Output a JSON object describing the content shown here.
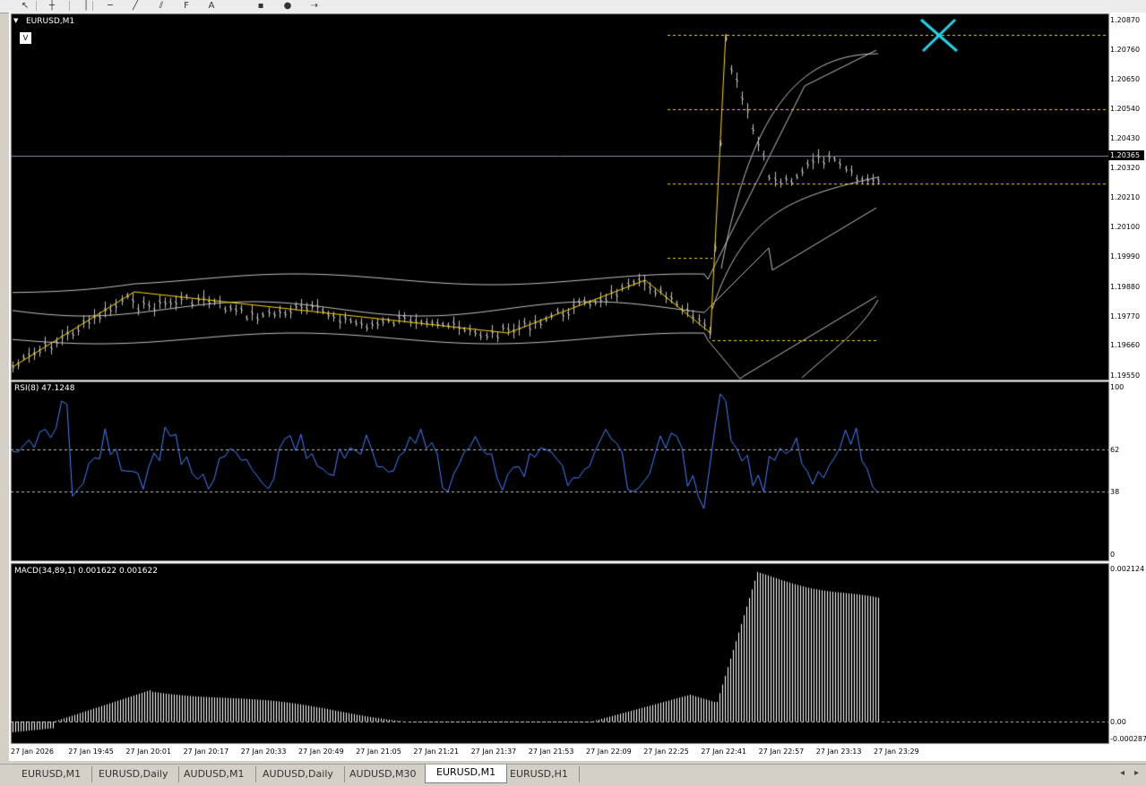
{
  "toolbar": {
    "buttons": [
      {
        "name": "cursor-icon",
        "glyph": "↖"
      },
      {
        "name": "crosshair-icon",
        "glyph": "┼"
      },
      {
        "name": "vertical-line-icon",
        "glyph": "│"
      },
      {
        "name": "horizontal-line-icon",
        "glyph": "─"
      },
      {
        "name": "trendline-icon",
        "glyph": "╱"
      },
      {
        "name": "equidistant-channel-icon",
        "glyph": "⫽"
      },
      {
        "name": "fibonacci-icon",
        "glyph": "F"
      },
      {
        "name": "text-icon",
        "glyph": "A"
      },
      {
        "name": "rectangle-icon",
        "glyph": "▪"
      },
      {
        "name": "ellipse-icon",
        "glyph": "●"
      },
      {
        "name": "arrows-icon",
        "glyph": "⇢"
      }
    ]
  },
  "chart": {
    "symbol_label": "EURUSD,M1",
    "v_button": "V",
    "current_price": "1.20365",
    "price_axis": [
      "1.20870",
      "1.20760",
      "1.20650",
      "1.20540",
      "1.20430",
      "1.20320",
      "1.20210",
      "1.20100",
      "1.19990",
      "1.19880",
      "1.19770",
      "1.19660",
      "1.19550"
    ],
    "rsi_label": "RSI(8) 47.1248",
    "rsi_axis": [
      "100",
      "62",
      "38",
      "0"
    ],
    "macd_label": "MACD(34,89,1) 0.001622 0.001622",
    "macd_axis": [
      "0.002124",
      "0.00",
      "-0.000287"
    ],
    "time_axis": [
      "27 Jan 2026",
      "27 Jan 19:45",
      "27 Jan 20:01",
      "27 Jan 20:17",
      "27 Jan 20:33",
      "27 Jan 20:49",
      "27 Jan 21:05",
      "27 Jan 21:21",
      "27 Jan 21:37",
      "27 Jan 21:53",
      "27 Jan 22:09",
      "27 Jan 22:25",
      "27 Jan 22:41",
      "27 Jan 22:57",
      "27 Jan 23:13",
      "27 Jan 23:29"
    ],
    "colors": {
      "background": "#000000",
      "candles": "#c0c0c0",
      "zigzag": "#ffd700",
      "bands": "#c0c0c0",
      "level_lines": "#ffd700",
      "rsi": "#4a7fff",
      "macd": "#ffffff",
      "cross_marker": "#22d3e6"
    }
  },
  "tabs": [
    {
      "label": "EURUSD,M1",
      "active": false
    },
    {
      "label": "EURUSD,Daily",
      "active": false
    },
    {
      "label": "AUDUSD,M1",
      "active": false
    },
    {
      "label": "AUDUSD,Daily",
      "active": false
    },
    {
      "label": "AUDUSD,M30",
      "active": false
    },
    {
      "label": "EURUSD,M1",
      "active": true
    },
    {
      "label": "EURUSD,H1",
      "active": false
    }
  ]
}
